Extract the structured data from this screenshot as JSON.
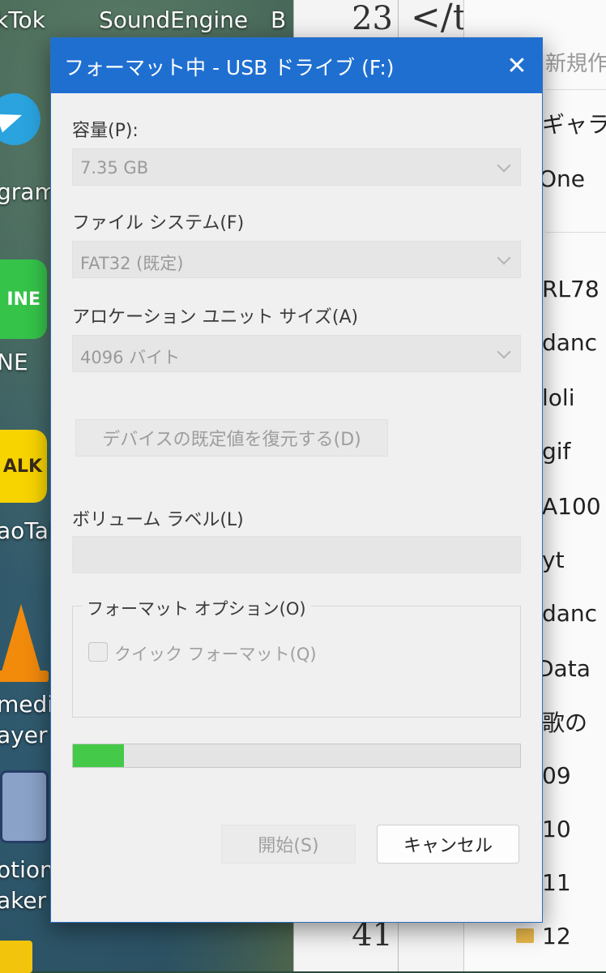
{
  "desktop": {
    "labels": [
      "kTok",
      "SoundEngine",
      "B",
      "gram",
      "NE",
      "aoTal",
      "medi",
      "ayer",
      "otion",
      "aker"
    ],
    "icons": {
      "line_text": "INE",
      "kakao_text": "ALK"
    }
  },
  "editor": {
    "line_numbers": [
      "23",
      "41"
    ],
    "code_fragment": "</t"
  },
  "explorer": {
    "new_button": "新規作",
    "items": [
      "ギャラ",
      "One",
      "RL78",
      "danc",
      "loli",
      "gif",
      "A100",
      "yt",
      "danc",
      "Data",
      "歌の",
      "09",
      "10",
      "11",
      "12"
    ]
  },
  "dialog": {
    "title": "フォーマット中 - USB ドライブ (F:)",
    "close_symbol": "✕",
    "capacity": {
      "label": "容量(P):",
      "value": "7.35 GB"
    },
    "filesystem": {
      "label": "ファイル システム(F)",
      "value": "FAT32 (既定)"
    },
    "allocation": {
      "label": "アロケーション ユニット サイズ(A)",
      "value": "4096 バイト"
    },
    "restore_button": "デバイスの既定値を復元する(D)",
    "volume_label": {
      "label": "ボリューム ラベル(L)",
      "value": ""
    },
    "format_options": {
      "title": "フォーマット オプション(O)",
      "quick_format_label": "クイック フォーマット(Q)",
      "quick_format_checked": false
    },
    "progress_fraction": 0.115,
    "progress_color": "#44c949",
    "start_button": "開始(S)",
    "cancel_button": "キャンセル"
  }
}
